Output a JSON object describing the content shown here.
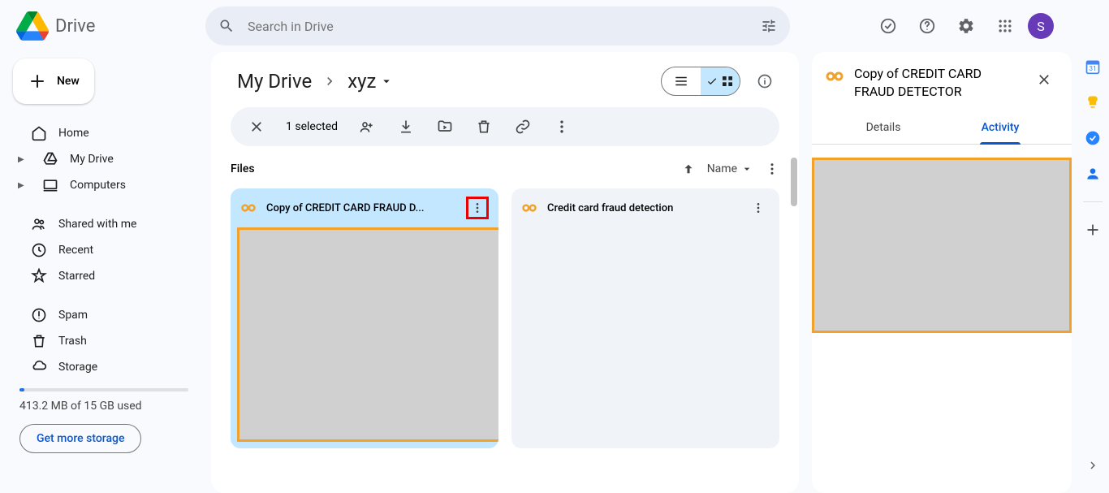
{
  "header": {
    "app_name": "Drive",
    "search_placeholder": "Search in Drive",
    "avatar_letter": "S"
  },
  "sidebar": {
    "new_label": "New",
    "items": [
      {
        "label": "Home",
        "icon": "home"
      },
      {
        "label": "My Drive",
        "icon": "drive",
        "arrow": true
      },
      {
        "label": "Computers",
        "icon": "computers",
        "arrow": true
      }
    ],
    "items2": [
      {
        "label": "Shared with me",
        "icon": "shared"
      },
      {
        "label": "Recent",
        "icon": "recent"
      },
      {
        "label": "Starred",
        "icon": "starred"
      }
    ],
    "items3": [
      {
        "label": "Spam",
        "icon": "spam"
      },
      {
        "label": "Trash",
        "icon": "trash"
      },
      {
        "label": "Storage",
        "icon": "storage"
      }
    ],
    "storage_text": "413.2 MB of 15 GB used",
    "get_storage": "Get more storage"
  },
  "breadcrumb": {
    "root": "My Drive",
    "current": "xyz"
  },
  "selection": {
    "count": "1 selected"
  },
  "files": {
    "section": "Files",
    "sort_label": "Name",
    "cards": [
      {
        "name": "Copy of CREDIT CARD FRAUD D...",
        "selected": true
      },
      {
        "name": "Credit card fraud detection",
        "selected": false
      }
    ]
  },
  "details": {
    "title": "Copy of CREDIT CARD FRAUD DETECTOR",
    "tabs": {
      "details": "Details",
      "activity": "Activity"
    }
  }
}
